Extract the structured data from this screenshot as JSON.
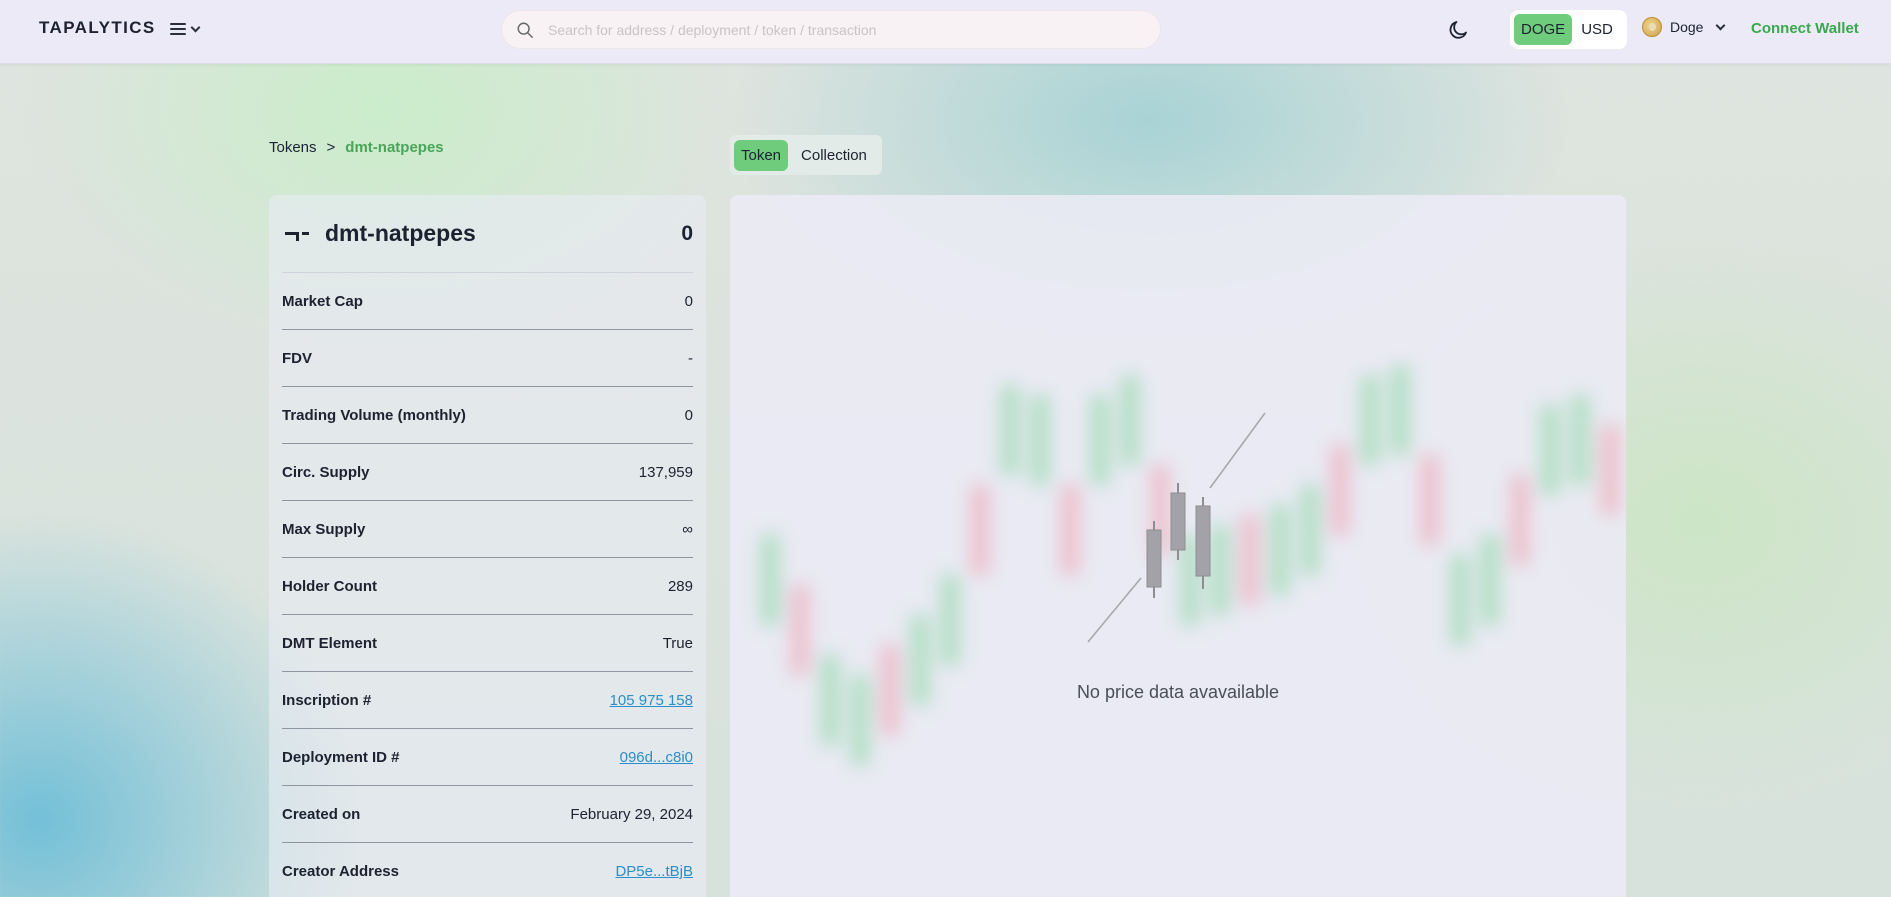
{
  "header": {
    "logo": "TAPALYTICS",
    "search_placeholder": "Search for address / deployment / token / transaction",
    "currency_options": [
      "DOGE",
      "USD"
    ],
    "currency_selected": "DOGE",
    "chain": "Doge",
    "connect_label": "Connect Wallet"
  },
  "breadcrumb": {
    "root": "Tokens",
    "separator": ">",
    "current": "dmt-natpepes"
  },
  "tabs": [
    {
      "label": "Token",
      "active": true
    },
    {
      "label": "Collection",
      "active": false
    }
  ],
  "token": {
    "name": "dmt-natpepes",
    "price": "0",
    "stats": [
      {
        "label": "Market Cap",
        "value": "0"
      },
      {
        "label": "FDV",
        "value": "-"
      },
      {
        "label": "Trading Volume (monthly)",
        "value": "0"
      },
      {
        "label": "Circ. Supply",
        "value": "137,959"
      },
      {
        "label": "Max Supply",
        "value": "∞"
      },
      {
        "label": "Holder Count",
        "value": "289"
      },
      {
        "label": "DMT Element",
        "value": "True"
      },
      {
        "label": "Inscription #",
        "value": "105 975 158",
        "link": true
      },
      {
        "label": "Deployment ID #",
        "value": "096d...c8i0",
        "link": true
      },
      {
        "label": "Created on",
        "value": "February 29, 2024"
      },
      {
        "label": "Creator Address",
        "value": "DP5e...tBjB",
        "link": true
      }
    ]
  },
  "chart": {
    "empty_message": "No price data avavailable"
  },
  "colors": {
    "accent_green": "#6fcc7d",
    "link_blue": "#2a8fc9",
    "connect_green": "#3aa84e"
  }
}
